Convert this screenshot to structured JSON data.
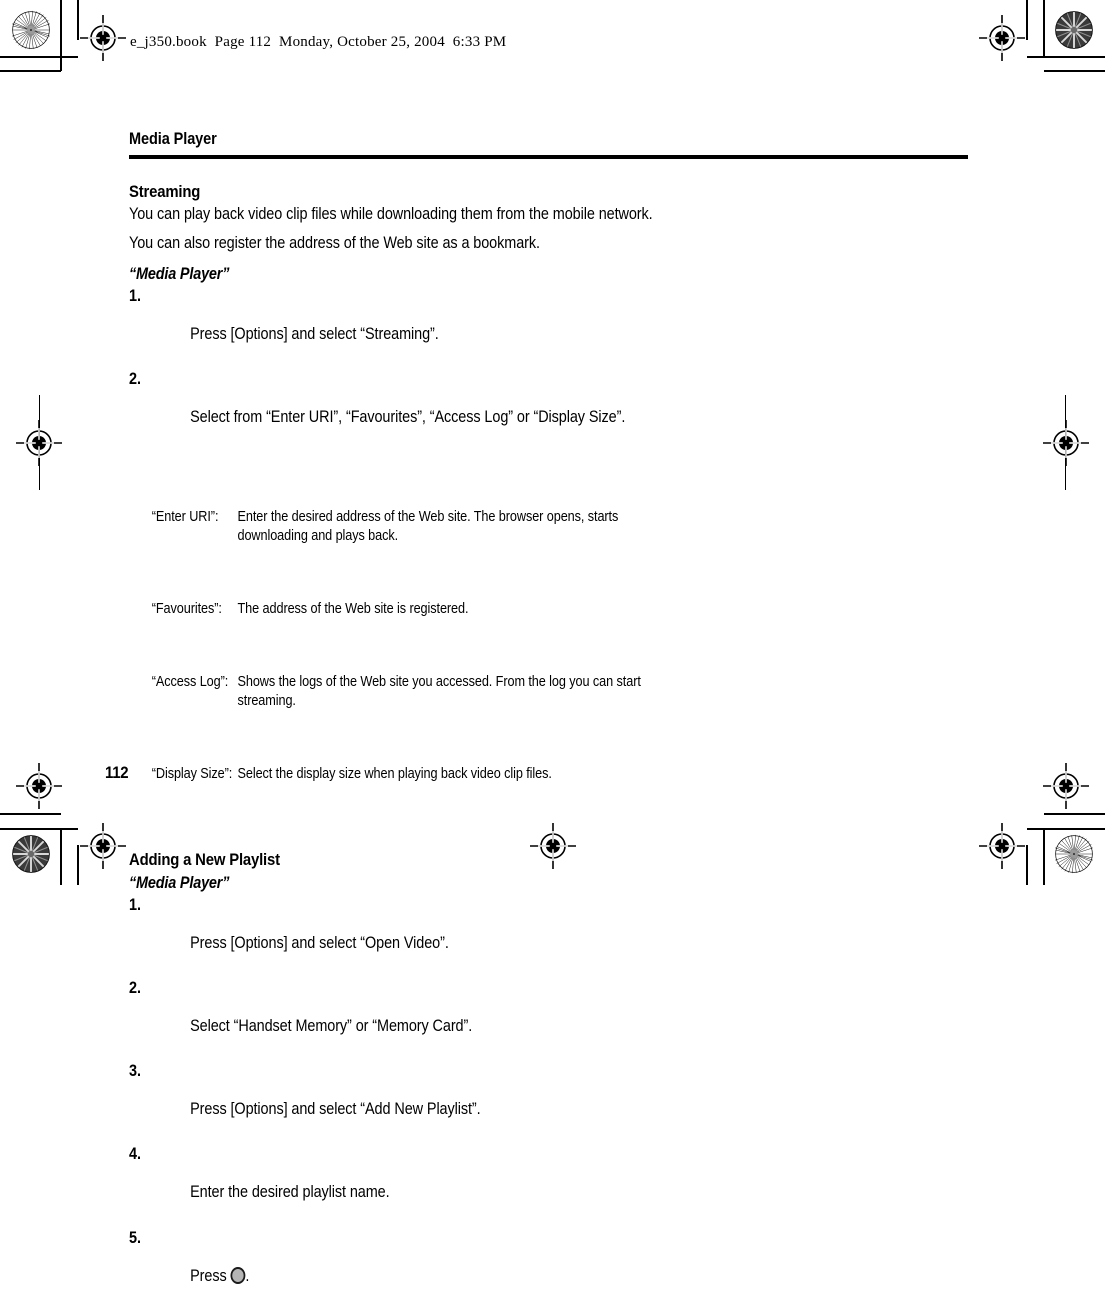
{
  "print_header": {
    "text": "e_j350.book  Page 112  Monday, October 25, 2004  6:33 PM"
  },
  "chapter": {
    "title": "Media Player"
  },
  "folio": {
    "page_number": "112"
  },
  "sections": [
    {
      "heading": "Streaming",
      "paragraphs": [
        "You can play back video clip files while downloading them from the mobile network.",
        "You can also register the address of the Web site as a bookmark."
      ],
      "subhead": "“Media Player”",
      "steps": [
        {
          "num": "1.",
          "text": "Press [Options] and select “Streaming”."
        },
        {
          "num": "2.",
          "text": "Select from “Enter URI”, “Favourites”, “Access Log” or “Display Size”."
        }
      ],
      "definitions": [
        {
          "term": "“Enter URI”:",
          "desc": "Enter the desired address of the Web site. The browser opens, starts downloading and plays back."
        },
        {
          "term": "“Favourites”:",
          "desc": "The address of the Web site is registered."
        },
        {
          "term": "“Access Log”:",
          "desc": "Shows the logs of the Web site you accessed. From the log you can start streaming."
        },
        {
          "term": "“Display Size”:",
          "desc": "Select the display size when playing back video clip files."
        }
      ]
    },
    {
      "heading": "Adding a New Playlist",
      "subhead": "“Media Player”",
      "steps": [
        {
          "num": "1.",
          "text": "Press [Options] and select “Open Video”."
        },
        {
          "num": "2.",
          "text": "Select “Handset Memory” or “Memory Card”."
        },
        {
          "num": "3.",
          "text": "Press [Options] and select “Add New Playlist”."
        },
        {
          "num": "4.",
          "text": "Enter the desired playlist name."
        },
        {
          "num": "5.",
          "text": "Press ",
          "text_after": ".",
          "icon": "round-select-key-icon"
        }
      ]
    }
  ],
  "colors": {
    "text": "#000000",
    "page_background": "#ffffff",
    "rule": "#000000",
    "key_icon_fill": "#b5b5b5",
    "key_icon_border": "#1a1a1a"
  }
}
